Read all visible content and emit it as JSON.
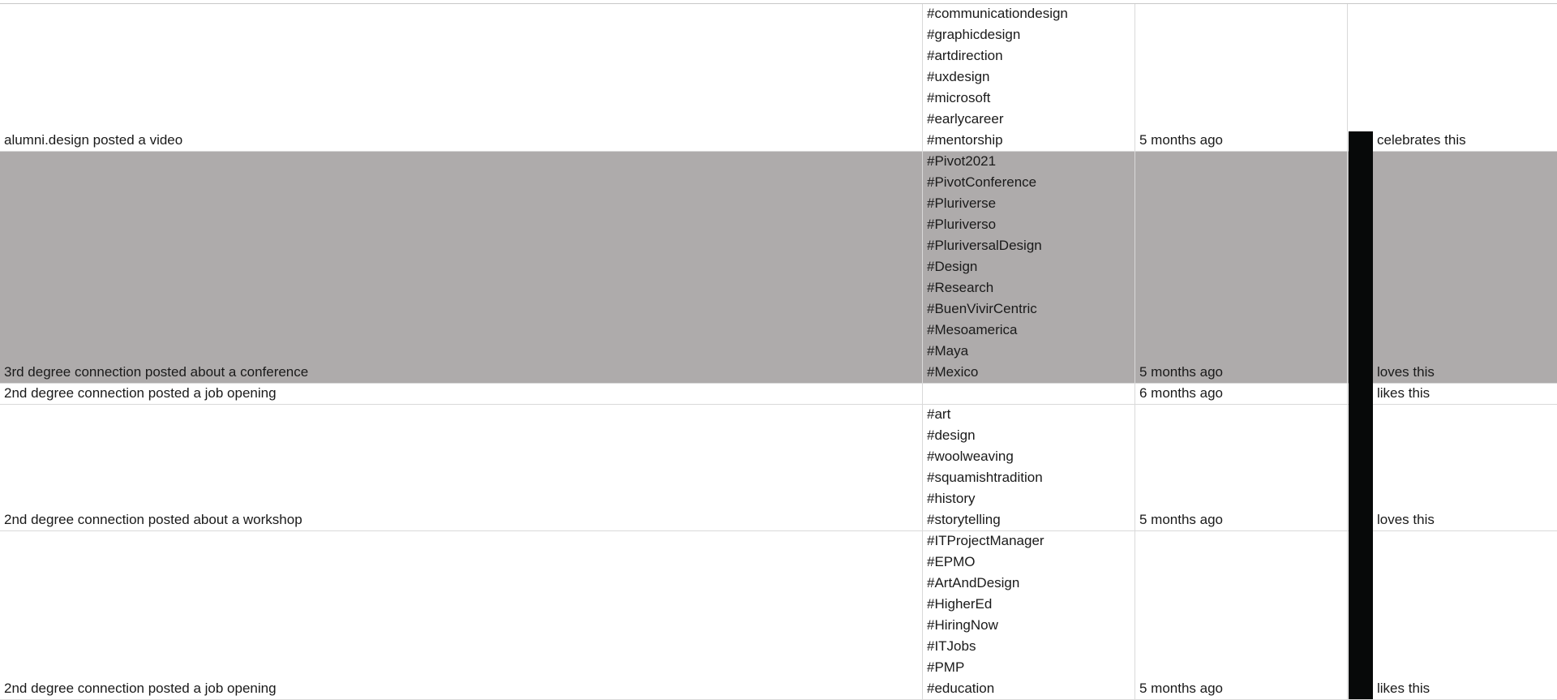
{
  "rows": [
    {
      "activity": "alumni.design posted a video",
      "tags": [
        "#communicationdesign",
        "#graphicdesign",
        "#artdirection",
        "#uxdesign",
        "#microsoft",
        "#earlycareer",
        "#mentorship"
      ],
      "time": "5 months ago",
      "reaction": "celebrates this",
      "highlighted": false
    },
    {
      "activity": "3rd degree connection posted about a conference",
      "tags": [
        "#Pivot2021",
        "#PivotConference",
        "#Pluriverse",
        "#Pluriverso",
        "#PluriversalDesign",
        "#Design",
        "#Research",
        "#BuenVivirCentric",
        "#Mesoamerica",
        "#Maya",
        "#Mexico"
      ],
      "time": "5 months ago",
      "reaction": "loves this",
      "highlighted": true
    },
    {
      "activity": "2nd degree connection posted a job opening",
      "tags": [],
      "time": "6 months ago",
      "reaction": "likes this",
      "highlighted": false
    },
    {
      "activity": "2nd degree connection posted about a workshop",
      "tags": [
        "#art",
        "#design",
        "#woolweaving",
        "#squamishtradition",
        "#history",
        "#storytelling"
      ],
      "time": "5 months ago",
      "reaction": "loves this",
      "highlighted": false
    },
    {
      "activity": "2nd degree connection posted a job opening",
      "tags": [
        "#ITProjectManager",
        "#EPMO",
        "#ArtAndDesign",
        "#HigherEd",
        "#HiringNow",
        "#ITJobs",
        "#PMP",
        "#education"
      ],
      "time": "5 months ago",
      "reaction": "likes this",
      "highlighted": false
    }
  ],
  "colors": {
    "highlight_row": "#aeabab",
    "black_bar": "#070909",
    "gridline": "#d9d9d9"
  }
}
